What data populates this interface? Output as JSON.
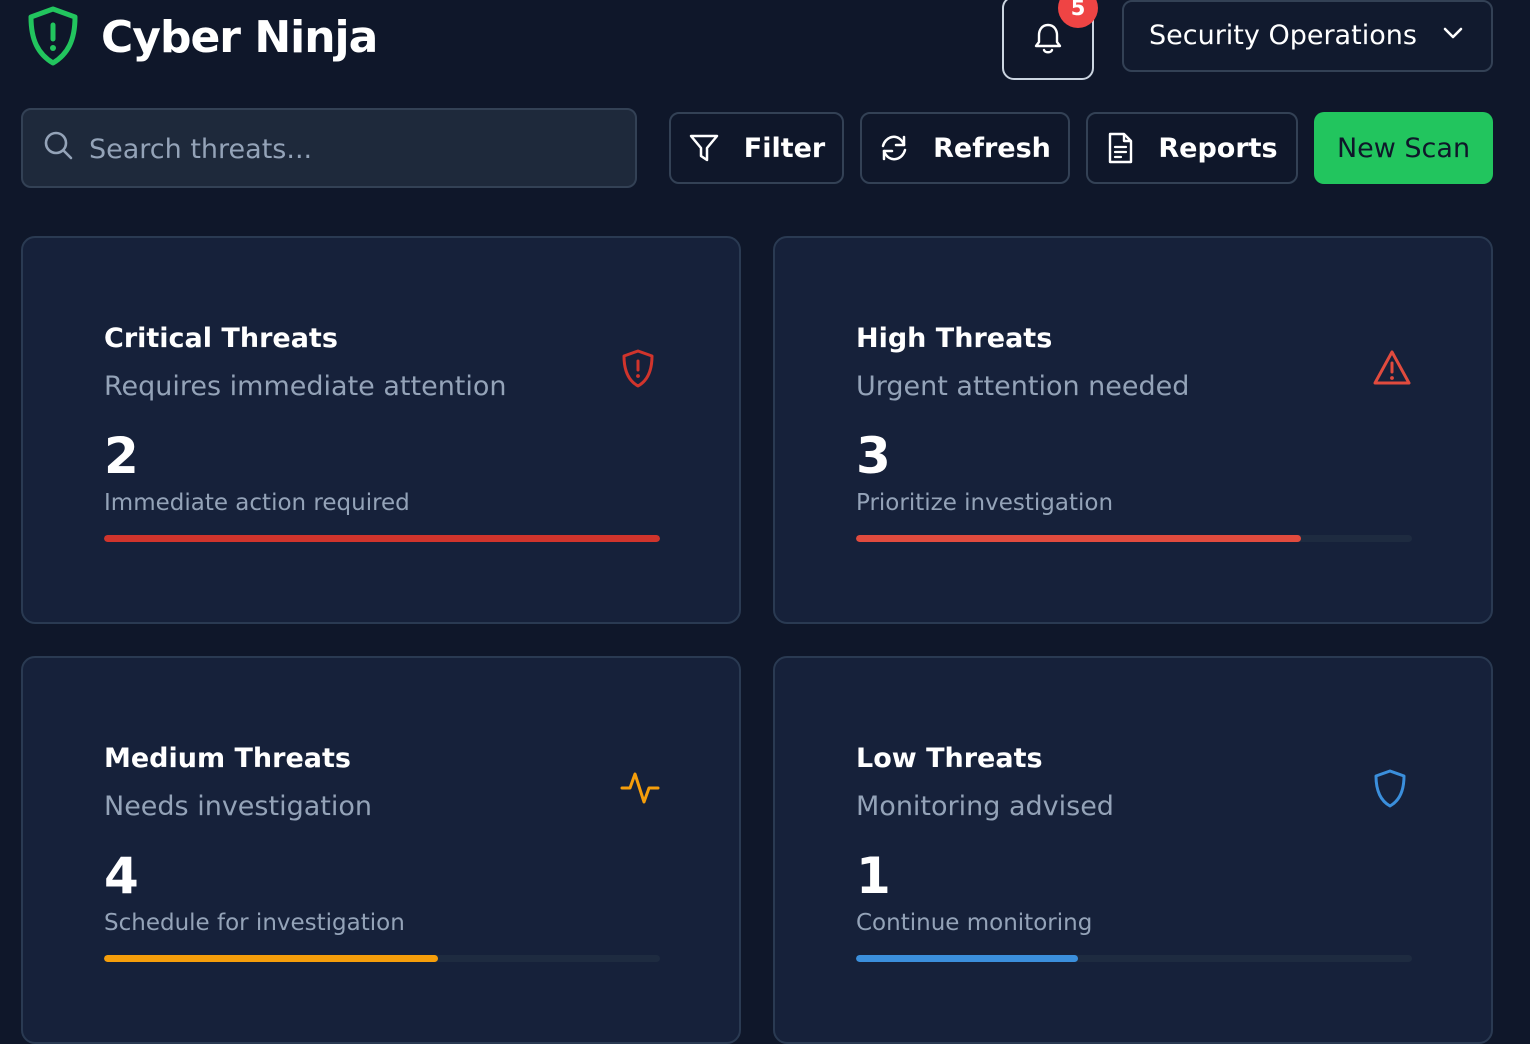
{
  "header": {
    "brand": "Cyber Ninja",
    "notifications": {
      "count": "5",
      "icon": "bell-icon"
    },
    "team_select": {
      "value": "Security Operations"
    }
  },
  "toolbar": {
    "search_placeholder": "Search threats...",
    "filter_label": "Filter",
    "refresh_label": "Refresh",
    "reports_label": "Reports",
    "new_scan_label": "New Scan"
  },
  "colors": {
    "background": "#0f172a",
    "card": "#16213a",
    "accent_green": "#22c55e",
    "critical": "#d0342c",
    "high": "#e14b3e",
    "medium": "#f59e0b",
    "low": "#3b8fdc"
  },
  "cards": [
    {
      "title": "Critical Threats",
      "subtitle": "Requires immediate attention",
      "count": "2",
      "note": "Immediate action required",
      "icon": "shield-alert-icon",
      "level": 1.0
    },
    {
      "title": "High Threats",
      "subtitle": "Urgent attention needed",
      "count": "3",
      "note": "Prioritize investigation",
      "icon": "warning-triangle-icon",
      "level": 0.8
    },
    {
      "title": "Medium Threats",
      "subtitle": "Needs investigation",
      "count": "4",
      "note": "Schedule for investigation",
      "icon": "activity-icon",
      "level": 0.6
    },
    {
      "title": "Low Threats",
      "subtitle": "Monitoring advised",
      "count": "1",
      "note": "Continue monitoring",
      "icon": "shield-icon",
      "level": 0.4
    }
  ]
}
